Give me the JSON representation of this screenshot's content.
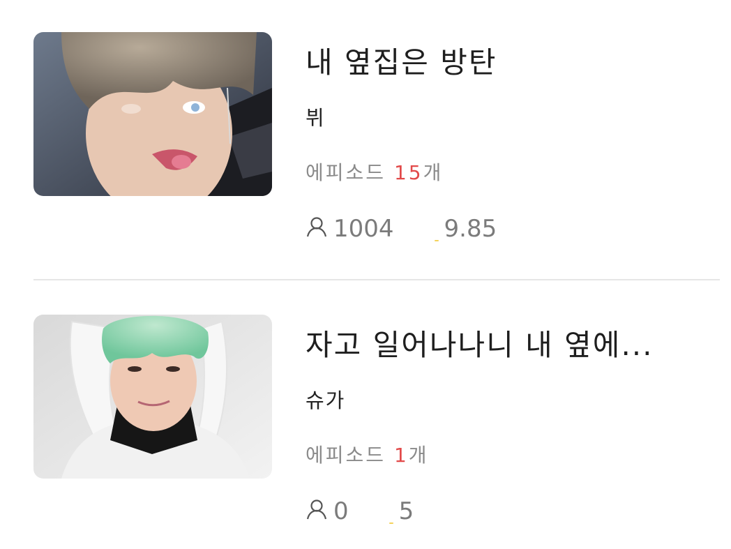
{
  "stories": [
    {
      "title": "내 옆집은 방탄",
      "author": "뷔",
      "episodes_prefix": "에피소드 ",
      "episodes_count": "15",
      "episodes_suffix": "개",
      "views": "1004",
      "rating": "9.85",
      "thumbnail_icon": "member-photo"
    },
    {
      "title": "자고 일어나나니 내 옆에...",
      "author": "슈가",
      "episodes_prefix": "에피소드 ",
      "episodes_count": "1",
      "episodes_suffix": "개",
      "views": "0",
      "rating": "5",
      "thumbnail_icon": "member-photo"
    }
  ],
  "colors": {
    "episode_count": "#e24a4a",
    "meta_text": "#8a8a8a",
    "divider": "#e6e6e6",
    "star": "#f4d25b"
  },
  "icons": {
    "views": "person-icon",
    "rating": "star-icon"
  }
}
